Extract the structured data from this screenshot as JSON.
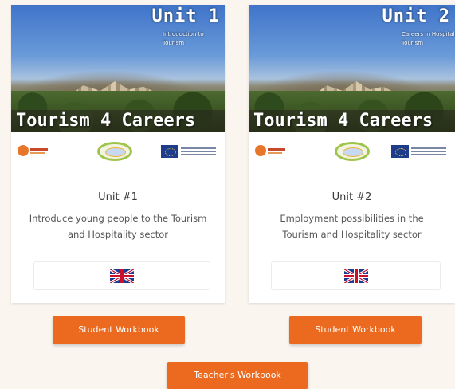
{
  "units": [
    {
      "cover_unit": "Unit 1",
      "cover_subtitle": "Introduction to Tourism",
      "brand": "Tourism 4 Careers",
      "title": "Unit #1",
      "description": "Introduce young people to the Tourism and Hospitality sector",
      "language_icon": "uk-flag-icon",
      "button_label": "Student Workbook"
    },
    {
      "cover_unit": "Unit 2",
      "cover_subtitle": "Careers in Hospitality Tourism",
      "brand": "Tourism 4 Careers",
      "title": "Unit #2",
      "description": "Employment possibilities in the Tourism and Hospitality sector",
      "language_icon": "uk-flag-icon",
      "button_label": "Student Workbook"
    }
  ],
  "teacher_button_label": "Teacher's Workbook",
  "colors": {
    "accent": "#ec6a1f",
    "background": "#fbf5f0",
    "card": "#ffffff"
  }
}
